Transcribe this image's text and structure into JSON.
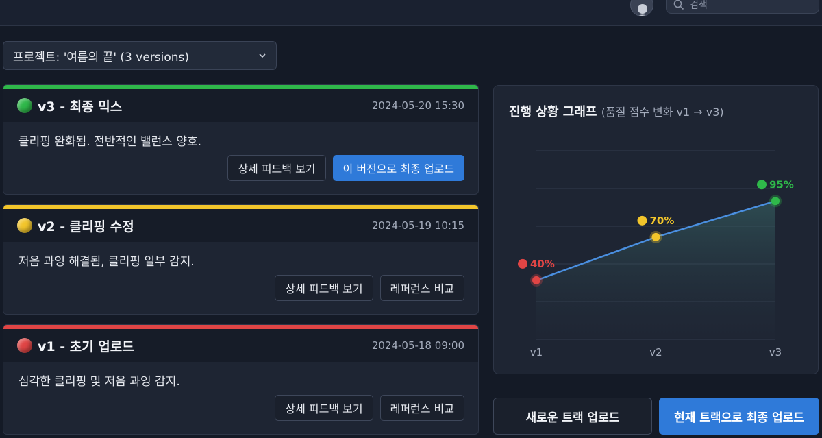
{
  "header": {
    "search_placeholder": "검색",
    "avatar_icon": "user-avatar-icon"
  },
  "project": {
    "label": "프로젝트: '여름의 끝' (3 versions)"
  },
  "colors": {
    "green": "#2fb84a",
    "yellow": "#f2c52b",
    "red": "#e04545",
    "accent": "#2f7ad9"
  },
  "versions": [
    {
      "title": "v3 - 최종 믹스",
      "date": "2024-05-20 15:30",
      "description": "클리핑 완화됨. 전반적인 밸런스 양호.",
      "status": "green",
      "buttons": [
        "상세 피드백 보기",
        "이 버전으로 최종 업로드"
      ]
    },
    {
      "title": "v2 - 클리핑 수정",
      "date": "2024-05-19 10:15",
      "description": "저음 과잉 해결됨, 클리핑 일부 감지.",
      "status": "yellow",
      "buttons": [
        "상세 피드백 보기",
        "레퍼런스 비교"
      ]
    },
    {
      "title": "v1 - 초기 업로드",
      "date": "2024-05-18 09:00",
      "description": "심각한 클리핑 및 저음 과잉 감지.",
      "status": "red",
      "buttons": [
        "상세 피드백 보기",
        "레퍼런스 비교"
      ]
    }
  ],
  "chart": {
    "title": "진행 상황 그래프",
    "subtitle": "(품질 점수 변화 v1 → v3)"
  },
  "chart_data": {
    "type": "line",
    "title": "진행 상황 그래프",
    "subtitle": "(품질 점수 변화 v1 → v3)",
    "categories": [
      "v1",
      "v2",
      "v3"
    ],
    "values": [
      40,
      70,
      95
    ],
    "labels": [
      "40%",
      "70%",
      "95%"
    ],
    "point_colors": [
      "#e04545",
      "#f2c52b",
      "#2fb84a"
    ],
    "ylim": [
      0,
      100
    ],
    "grid": true,
    "line_color": "#4a8fe0"
  },
  "footer": {
    "upload_new": "새로운 트랙 업로드",
    "final_upload": "현재 트랙으로 최종 업로드"
  }
}
